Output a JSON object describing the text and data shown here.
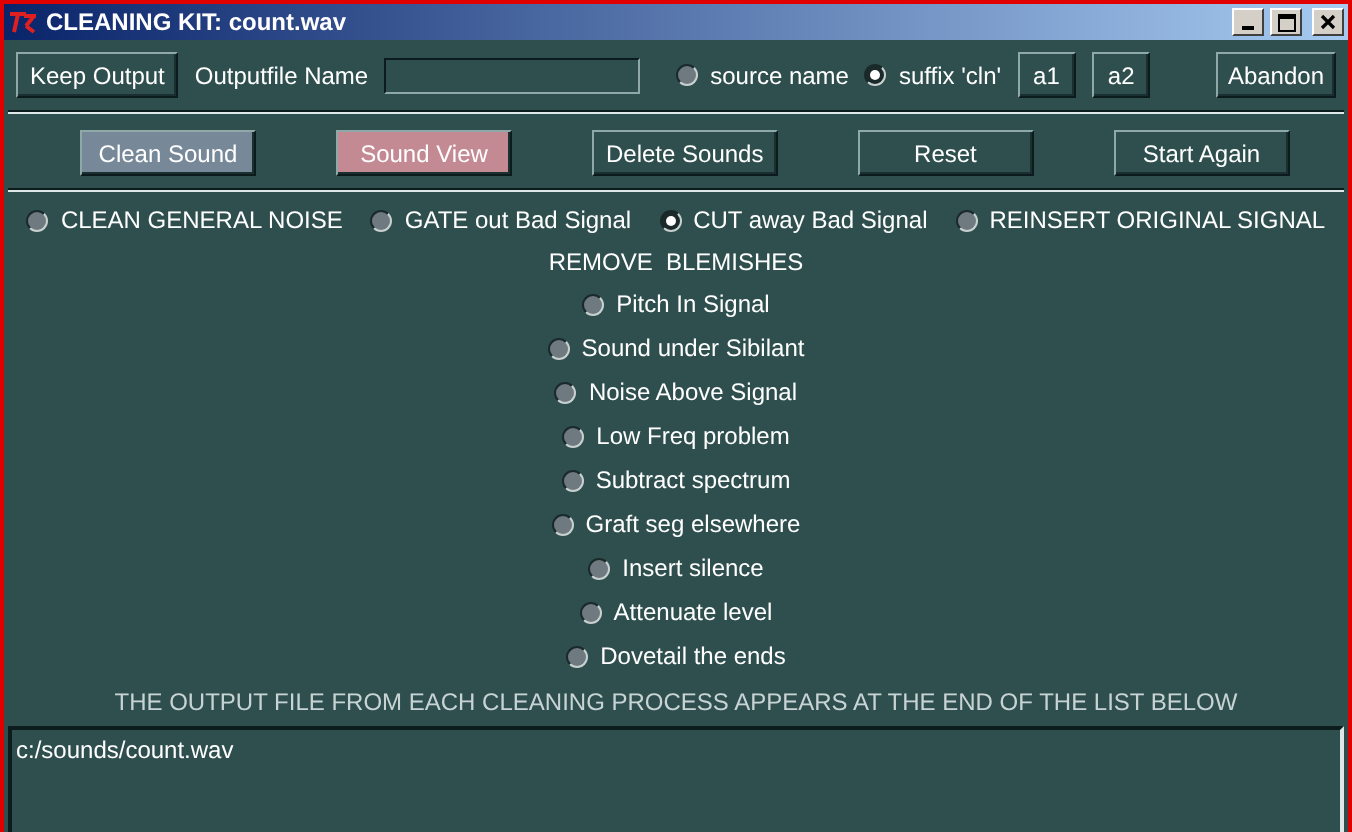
{
  "window": {
    "title": "CLEANING KIT: count.wav"
  },
  "top_bar": {
    "keep_button": "Keep Output",
    "outfile_label": "Outputfile Name",
    "naming": [
      {
        "label": "source name",
        "selected": false
      },
      {
        "label": "suffix 'cln'",
        "selected": true
      }
    ],
    "small_buttons": [
      "a1",
      "a2"
    ],
    "abandon_button": "Abandon"
  },
  "actions": [
    {
      "label": "Clean Sound",
      "color": "#778899"
    },
    {
      "label": "Sound View",
      "color": "#c48a94"
    },
    {
      "label": "Delete Sounds",
      "color": "#2f4f4f"
    },
    {
      "label": "Reset",
      "color": "#2f4f4f"
    },
    {
      "label": "Start Again",
      "color": "#2f4f4f"
    }
  ],
  "modes": [
    {
      "label": "CLEAN GENERAL NOISE",
      "selected": false
    },
    {
      "label": "GATE out Bad Signal",
      "selected": false
    },
    {
      "label": "CUT away Bad Signal",
      "selected": true
    },
    {
      "label": "REINSERT ORIGINAL SIGNAL",
      "selected": false
    }
  ],
  "blemishes": {
    "heading": "REMOVE  BLEMISHES",
    "items": [
      {
        "label": "Pitch In Signal",
        "selected": false
      },
      {
        "label": "Sound under Sibilant",
        "selected": false
      },
      {
        "label": "Noise Above Signal",
        "selected": false
      },
      {
        "label": "Low Freq problem",
        "selected": false
      },
      {
        "label": "Subtract spectrum",
        "selected": false
      },
      {
        "label": "Graft seg elsewhere",
        "selected": false
      },
      {
        "label": "Insert silence",
        "selected": false
      },
      {
        "label": "Attenuate level",
        "selected": false
      },
      {
        "label": "Dovetail the ends",
        "selected": false
      }
    ]
  },
  "output_note": "THE OUTPUT FILE FROM EACH CLEANING PROCESS APPEARS AT THE END OF THE LIST BELOW",
  "output_list": [
    "c:/sounds/count.wav"
  ]
}
